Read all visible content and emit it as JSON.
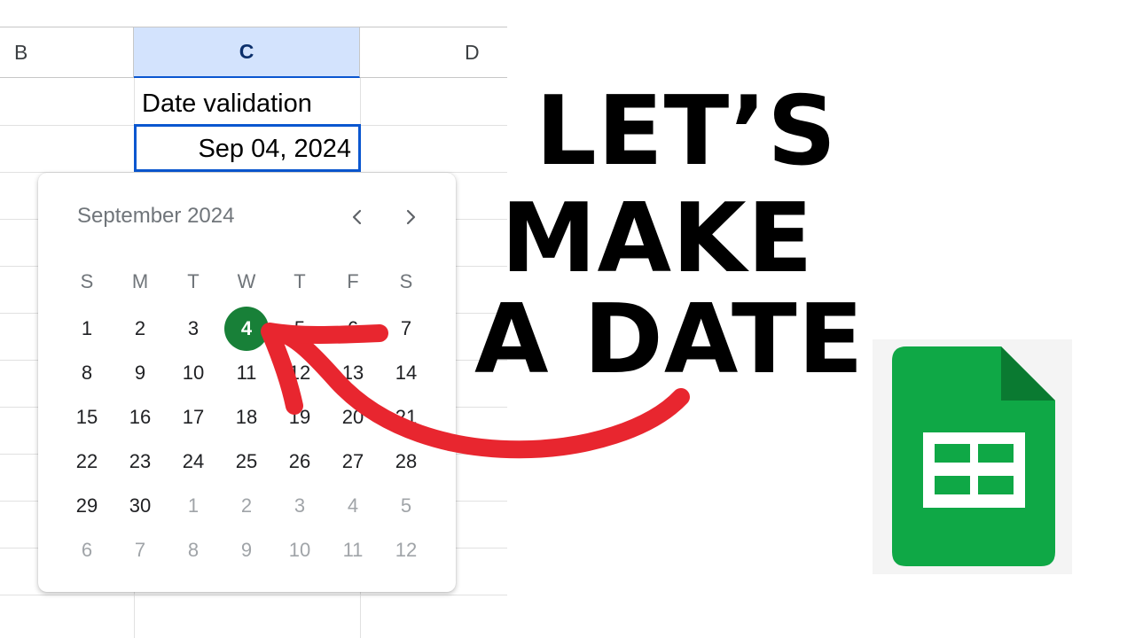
{
  "sheet": {
    "columns": [
      "B",
      "C",
      "D"
    ],
    "cells": {
      "c1": "Date validation",
      "c2": "Sep 04, 2024"
    }
  },
  "date_picker": {
    "month_label": "September 2024",
    "nav": {
      "prev_icon": "chevron-left-icon",
      "next_icon": "chevron-right-icon"
    },
    "weekdays": [
      "S",
      "M",
      "T",
      "W",
      "T",
      "F",
      "S"
    ],
    "weeks": [
      [
        "1",
        "2",
        "3",
        "4",
        "5",
        "6",
        "7"
      ],
      [
        "8",
        "9",
        "10",
        "11",
        "12",
        "13",
        "14"
      ],
      [
        "15",
        "16",
        "17",
        "18",
        "19",
        "20",
        "21"
      ],
      [
        "22",
        "23",
        "24",
        "25",
        "26",
        "27",
        "28"
      ],
      [
        "29",
        "30",
        "1",
        "2",
        "3",
        "4",
        "5"
      ],
      [
        "6",
        "7",
        "8",
        "9",
        "10",
        "11",
        "12"
      ]
    ],
    "selected_day": "4",
    "selected_color": "#188038"
  },
  "headline": {
    "line1": "LET’S",
    "line2": "MAKE",
    "line3": "A DATE"
  },
  "colors": {
    "arrow": "#e8262f",
    "logo_green": "#0fa846",
    "selection_blue": "#0b57d0",
    "header_highlight": "#d3e3fd"
  },
  "icons": {
    "logo": "google-sheets-icon",
    "arrow": "curved-arrow-icon"
  }
}
